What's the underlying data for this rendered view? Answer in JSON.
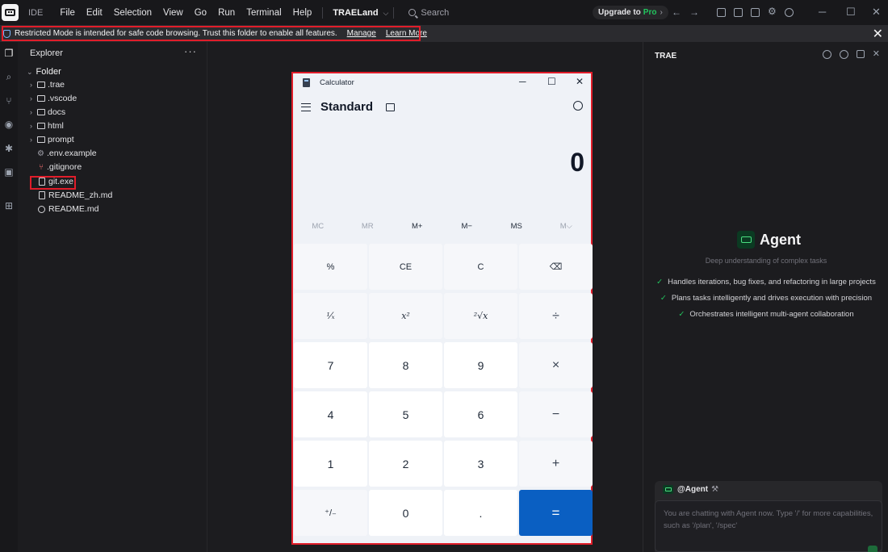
{
  "titlebar": {
    "ide_label": "IDE",
    "menu": [
      "File",
      "Edit",
      "Selection",
      "View",
      "Go",
      "Run",
      "Terminal",
      "Help"
    ],
    "project": "TRAELand",
    "search_placeholder": "Search",
    "upgrade_prefix": "Upgrade to",
    "upgrade_pro": "Pro",
    "upgrade_arrow": "›"
  },
  "banner": {
    "message": "Restricted Mode is intended for safe code browsing. Trust this folder to enable all features.",
    "manage": "Manage",
    "learn_more": "Learn More",
    "close": "✕"
  },
  "explorer": {
    "title": "Explorer",
    "more": "···",
    "root": "Folder",
    "items": [
      {
        "label": ".trae",
        "kind": "folder"
      },
      {
        "label": ".vscode",
        "kind": "folder"
      },
      {
        "label": "docs",
        "kind": "folder"
      },
      {
        "label": "html",
        "kind": "folder"
      },
      {
        "label": "prompt",
        "kind": "folder"
      },
      {
        "label": ".env.example",
        "kind": "gear"
      },
      {
        "label": ".gitignore",
        "kind": "git"
      },
      {
        "label": "git.exe",
        "kind": "file"
      },
      {
        "label": "README_zh.md",
        "kind": "file"
      },
      {
        "label": "README.md",
        "kind": "info"
      }
    ]
  },
  "calculator": {
    "title": "Calculator",
    "mode": "Standard",
    "display": "0",
    "memory": [
      "MC",
      "MR",
      "M+",
      "M−",
      "MS",
      "M⌵"
    ],
    "keys": [
      {
        "label": "%",
        "type": "fn"
      },
      {
        "label": "CE",
        "type": "fn"
      },
      {
        "label": "C",
        "type": "fn"
      },
      {
        "label": "⌫",
        "type": "fn"
      },
      {
        "label": "¹⁄ₓ",
        "type": "fn"
      },
      {
        "label": "x²",
        "type": "fn"
      },
      {
        "label": "²√x",
        "type": "fn"
      },
      {
        "label": "÷",
        "type": "op"
      },
      {
        "label": "7",
        "type": "num"
      },
      {
        "label": "8",
        "type": "num"
      },
      {
        "label": "9",
        "type": "num"
      },
      {
        "label": "×",
        "type": "op"
      },
      {
        "label": "4",
        "type": "num"
      },
      {
        "label": "5",
        "type": "num"
      },
      {
        "label": "6",
        "type": "num"
      },
      {
        "label": "−",
        "type": "op"
      },
      {
        "label": "1",
        "type": "num"
      },
      {
        "label": "2",
        "type": "num"
      },
      {
        "label": "3",
        "type": "num"
      },
      {
        "label": "+",
        "type": "op"
      },
      {
        "label": "⁺/₋",
        "type": "fn"
      },
      {
        "label": "0",
        "type": "num"
      },
      {
        "label": ".",
        "type": "num"
      },
      {
        "label": "=",
        "type": "eq"
      }
    ]
  },
  "agent_panel": {
    "title": "TRAE",
    "agent_name": "Agent",
    "subtitle": "Deep understanding of complex tasks",
    "features": [
      "Handles iterations, bug fixes, and refactoring in large projects",
      "Plans tasks intelligently and drives execution with precision",
      "Orchestrates intelligent multi-agent collaboration"
    ],
    "chat_agent": "@Agent",
    "chat_placeholder": "You are chatting with Agent now. Type '/' for more capabilities, such as '/plan', '/spec'"
  },
  "colors": {
    "accent_green": "#22c55e",
    "equals_blue": "#0a5fc2",
    "highlight_red": "#e11d2a"
  }
}
